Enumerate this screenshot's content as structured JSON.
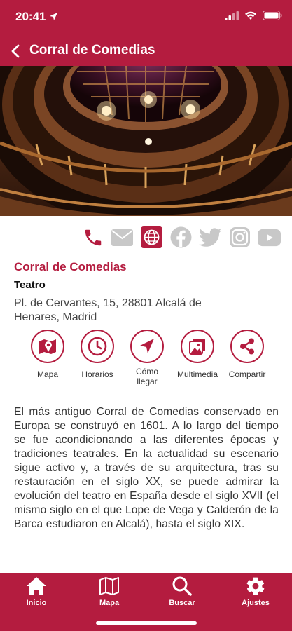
{
  "status_bar": {
    "time": "20:41"
  },
  "nav": {
    "title": "Corral de Comedias"
  },
  "place": {
    "title": "Corral de Comedias",
    "type": "Teatro",
    "address": "Pl. de Cervantes, 15, 28801 Alcalá de Henares, Madrid"
  },
  "contact_icons": [
    "phone-icon",
    "mail-icon",
    "globe-icon",
    "facebook-icon",
    "twitter-icon",
    "instagram-icon",
    "youtube-icon"
  ],
  "actions": [
    {
      "label": "Mapa",
      "icon": "map-icon"
    },
    {
      "label": "Horarios",
      "icon": "clock-icon"
    },
    {
      "label": "Cómo llegar",
      "icon": "navigation-icon"
    },
    {
      "label": "Multimedia",
      "icon": "gallery-icon"
    },
    {
      "label": "Compartir",
      "icon": "share-icon"
    }
  ],
  "description": "El más antiguo Corral de Comedias conservado en Europa se construyó en 1601. A lo largo del tiempo se fue acondicionando a las diferentes épocas y tradiciones teatrales. En la actualidad su escenario sigue activo y, a través de su arquitectura, tras su restauración en el siglo XX, se puede admirar la evolución del teatro en España desde el siglo XVII (el mismo siglo en el que Lope de Vega y Calderón de la Barca estudiaron en Alcalá), hasta el siglo XIX.",
  "tabs": [
    {
      "label": "Inicio",
      "icon": "home-icon"
    },
    {
      "label": "Mapa",
      "icon": "map-icon"
    },
    {
      "label": "Buscar",
      "icon": "search-icon"
    },
    {
      "label": "Ajustes",
      "icon": "settings-icon"
    }
  ],
  "colors": {
    "brand": "#b41c3f",
    "inactive_icon": "#c8c8c8"
  }
}
